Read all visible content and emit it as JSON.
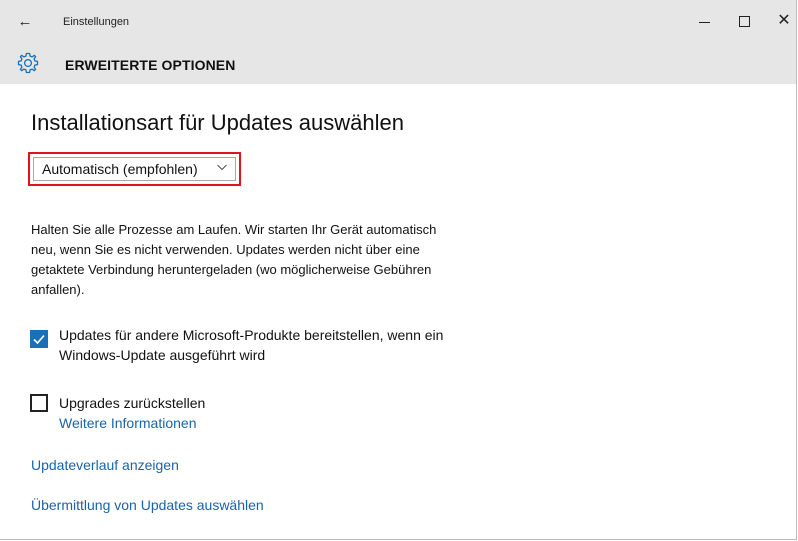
{
  "window": {
    "app_title": "Einstellungen",
    "back_icon": "back-arrow-icon",
    "minimize_icon": "minimize-icon",
    "maximize_icon": "maximize-icon",
    "close_icon": "close-icon"
  },
  "header": {
    "icon": "gear-icon",
    "title": "ERWEITERTE OPTIONEN"
  },
  "main": {
    "title": "Installationsart für Updates auswählen",
    "install_type": {
      "selected": "Automatisch (empfohlen)",
      "highlight_color": "#e0141c"
    },
    "description": "Halten Sie alle Prozesse am Laufen. Wir starten Ihr Gerät automatisch neu, wenn Sie es nicht verwenden. Updates werden nicht über eine getaktete Verbindung heruntergeladen (wo möglicherweise Gebühren anfallen).",
    "ms_products": {
      "checked": true,
      "label_line1": "Updates für andere Microsoft-Produkte bereitstellen, wenn ein",
      "label_line2": "Windows-Update ausgeführt wird"
    },
    "defer_upgrades": {
      "checked": false,
      "label": "Upgrades zurückstellen",
      "more_info_link": "Weitere Informationen"
    },
    "history_link": "Updateverlauf anzeigen",
    "delivery_link": "Übermittlung von Updates auswählen"
  },
  "colors": {
    "accent": "#1b6fb6",
    "link": "#1a63a8",
    "titlebar_bg": "#e6e6e6"
  }
}
